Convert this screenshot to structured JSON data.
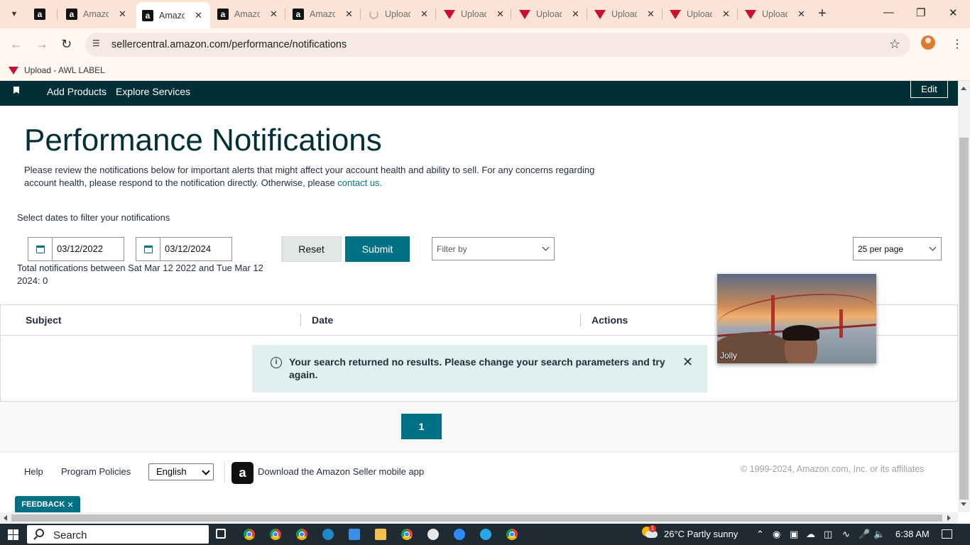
{
  "browser": {
    "tabs": [
      {
        "title": "",
        "icon": "amazon-icon"
      },
      {
        "title": "Amazon",
        "icon": "amazon-icon"
      },
      {
        "title": "Amazon",
        "icon": "amazon-icon",
        "active": true
      },
      {
        "title": "Amazon",
        "icon": "amazon-icon"
      },
      {
        "title": "Amazon",
        "icon": "amazon-icon"
      },
      {
        "title": "Upload",
        "icon": "loading-icon"
      },
      {
        "title": "Upload",
        "icon": "awl-label-icon"
      },
      {
        "title": "Upload",
        "icon": "awl-label-icon"
      },
      {
        "title": "Upload",
        "icon": "awl-label-icon"
      },
      {
        "title": "Upload",
        "icon": "awl-label-icon"
      },
      {
        "title": "Upload",
        "icon": "awl-label-icon"
      }
    ],
    "url": "sellercentral.amazon.com/performance/notifications",
    "bookmark": "Upload - AWL LABEL"
  },
  "topnav": {
    "add_products": "Add Products",
    "explore_services": "Explore Services",
    "edit": "Edit"
  },
  "page": {
    "title": "Performance Notifications",
    "intro": "Please review the notifications below for important alerts that might affect your account health and ability to sell. For any concerns regarding account health, please respond to the notification directly. Otherwise, please ",
    "contact_link": "contact us.",
    "filter_label": "Select dates to filter your notifications",
    "start_date": "03/12/2022",
    "end_date": "03/12/2024",
    "reset": "Reset",
    "submit": "Submit",
    "filter_by_placeholder": "Filter by",
    "per_page": "25 per page",
    "total": "Total notifications between Sat Mar 12 2022 and Tue Mar 12 2024: 0"
  },
  "table": {
    "columns": [
      "Subject",
      "Date",
      "Actions"
    ],
    "alert": "Your search returned no results. Please change your search parameters and try again."
  },
  "pagination": {
    "current": "1"
  },
  "footer": {
    "help": "Help",
    "program_policies": "Program Policies",
    "language": "English",
    "app_promo": "Download the Amazon Seller mobile app",
    "copyright": "© 1999-2024, Amazon.com, Inc. or its affiliates",
    "feedback": "FEEDBACK"
  },
  "video": {
    "name": "Jolly"
  },
  "taskbar": {
    "search": "Search",
    "weather": "26°C  Partly sunny",
    "weather_badge": "1",
    "time": "6:38 AM"
  },
  "colors": {
    "nav_bg": "#002f36",
    "accent": "#007185",
    "alert_bg": "#e0eff0",
    "tabstrip_bg": "#fbe3d6"
  }
}
